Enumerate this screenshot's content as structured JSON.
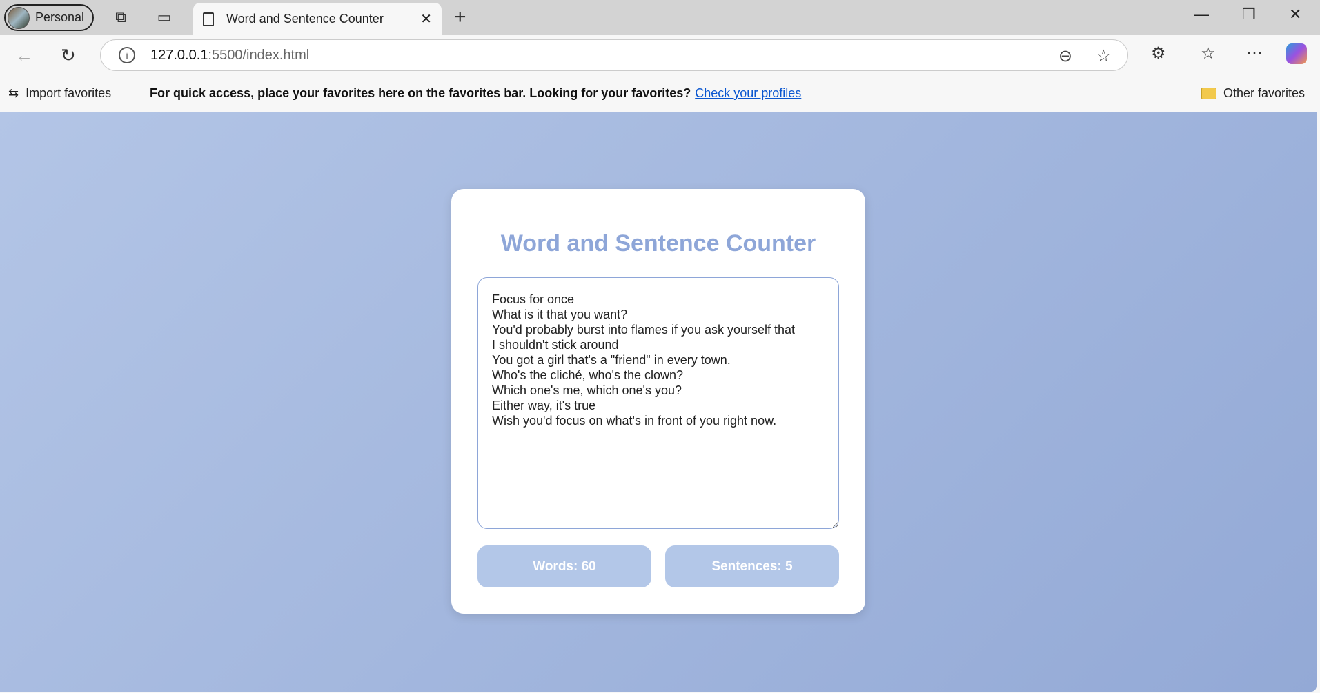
{
  "browser": {
    "profile_label": "Personal",
    "tab_title": "Word and Sentence Counter",
    "url_host": "127.0.0.1",
    "url_rest": ":5500/index.html",
    "import_favorites": "Import favorites",
    "favorites_message": "For quick access, place your favorites here on the favorites bar. Looking for your favorites?",
    "check_profiles": "Check your profiles",
    "other_favorites": "Other favorites"
  },
  "app": {
    "title": "Word and Sentence Counter",
    "text": "Focus for once\nWhat is it that you want?\nYou'd probably burst into flames if you ask yourself that\nI shouldn't stick around\nYou got a girl that's a \"friend\" in every town.\nWho's the cliché, who's the clown?\nWhich one's me, which one's you?\nEither way, it's true\nWish you'd focus on what's in front of you right now.",
    "words_label": "Words: 60",
    "sentences_label": "Sentences: 5"
  }
}
